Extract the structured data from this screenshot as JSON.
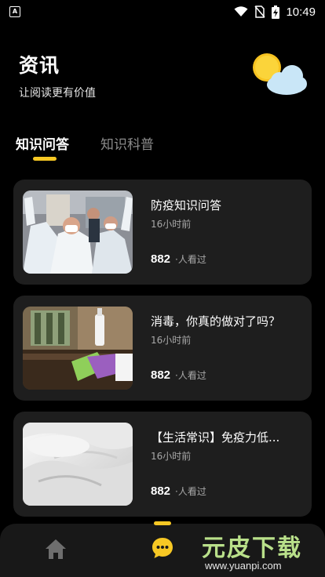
{
  "status_bar": {
    "app_badge": "A",
    "time": "10:49",
    "icons": [
      "wifi-icon",
      "no-sim-icon",
      "battery-charging-icon"
    ]
  },
  "header": {
    "title": "资讯",
    "subtitle": "让阅读更有价值",
    "weather_icon": "sun-cloud-icon"
  },
  "tabs": [
    {
      "label": "知识问答",
      "active": true
    },
    {
      "label": "知识科普",
      "active": false
    }
  ],
  "articles": [
    {
      "title": "防疫知识问答",
      "time": "16小时前",
      "views": "882",
      "views_label": "·人看过",
      "thumb": "medical-workers-photo"
    },
    {
      "title": "消毒，你真的做对了吗？",
      "time": "16小时前",
      "views": "882",
      "views_label": "·人看过",
      "thumb": "disinfection-wiping-photo"
    },
    {
      "title": "【生活常识】免疫力低...",
      "time": "16小时前",
      "views": "882",
      "views_label": "·人看过",
      "thumb": "white-bedding-photo"
    }
  ],
  "bottom_nav": {
    "items": [
      {
        "icon": "home-icon",
        "active": false
      },
      {
        "icon": "chat-bubble-icon",
        "active": true
      }
    ]
  },
  "watermark": {
    "text": "元皮下载",
    "url": "www.yuanpi.com"
  },
  "colors": {
    "background": "#000000",
    "card": "#1e1e1e",
    "accent": "#f7c824",
    "muted_text": "#a9a9a9"
  }
}
